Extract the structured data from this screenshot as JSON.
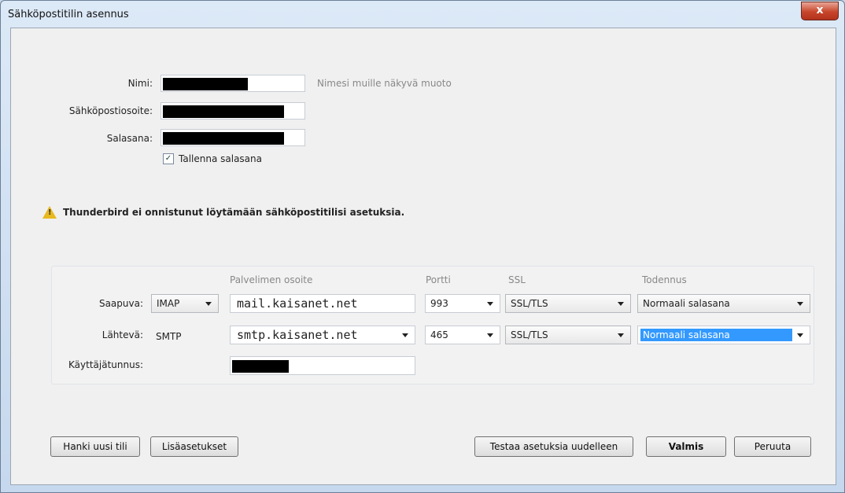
{
  "window": {
    "title": "Sähköpostitilin asennus",
    "close_glyph": "x"
  },
  "form": {
    "name_label": "Nimi:",
    "name_hint": "Nimesi muille näkyvä muoto",
    "email_label": "Sähköpostiosoite:",
    "password_label": "Salasana:",
    "remember_password_label": "Tallenna salasana",
    "remember_password_checked": true
  },
  "warning": {
    "text": "Thunderbird ei onnistunut löytämään sähköpostitilisi asetuksia."
  },
  "server": {
    "headers": {
      "address": "Palvelimen osoite",
      "port": "Portti",
      "ssl": "SSL",
      "auth": "Todennus"
    },
    "incoming": {
      "label": "Saapuva:",
      "protocol": "IMAP",
      "address": "mail.kaisanet.net",
      "port": "993",
      "ssl": "SSL/TLS",
      "auth": "Normaali salasana"
    },
    "outgoing": {
      "label": "Lähtevä:",
      "protocol": "SMTP",
      "address": "smtp.kaisanet.net",
      "port": "465",
      "ssl": "SSL/TLS",
      "auth": "Normaali salasana"
    },
    "username_label": "Käyttäjätunnus:"
  },
  "buttons": {
    "new_account": "Hanki uusi tili",
    "advanced": "Lisäasetukset",
    "retest": "Testaa asetuksia uudelleen",
    "done": "Valmis",
    "cancel": "Peruuta"
  },
  "colors": {
    "selection": "#3399ff",
    "warning": "#e8b820",
    "close": "#c7452a"
  }
}
